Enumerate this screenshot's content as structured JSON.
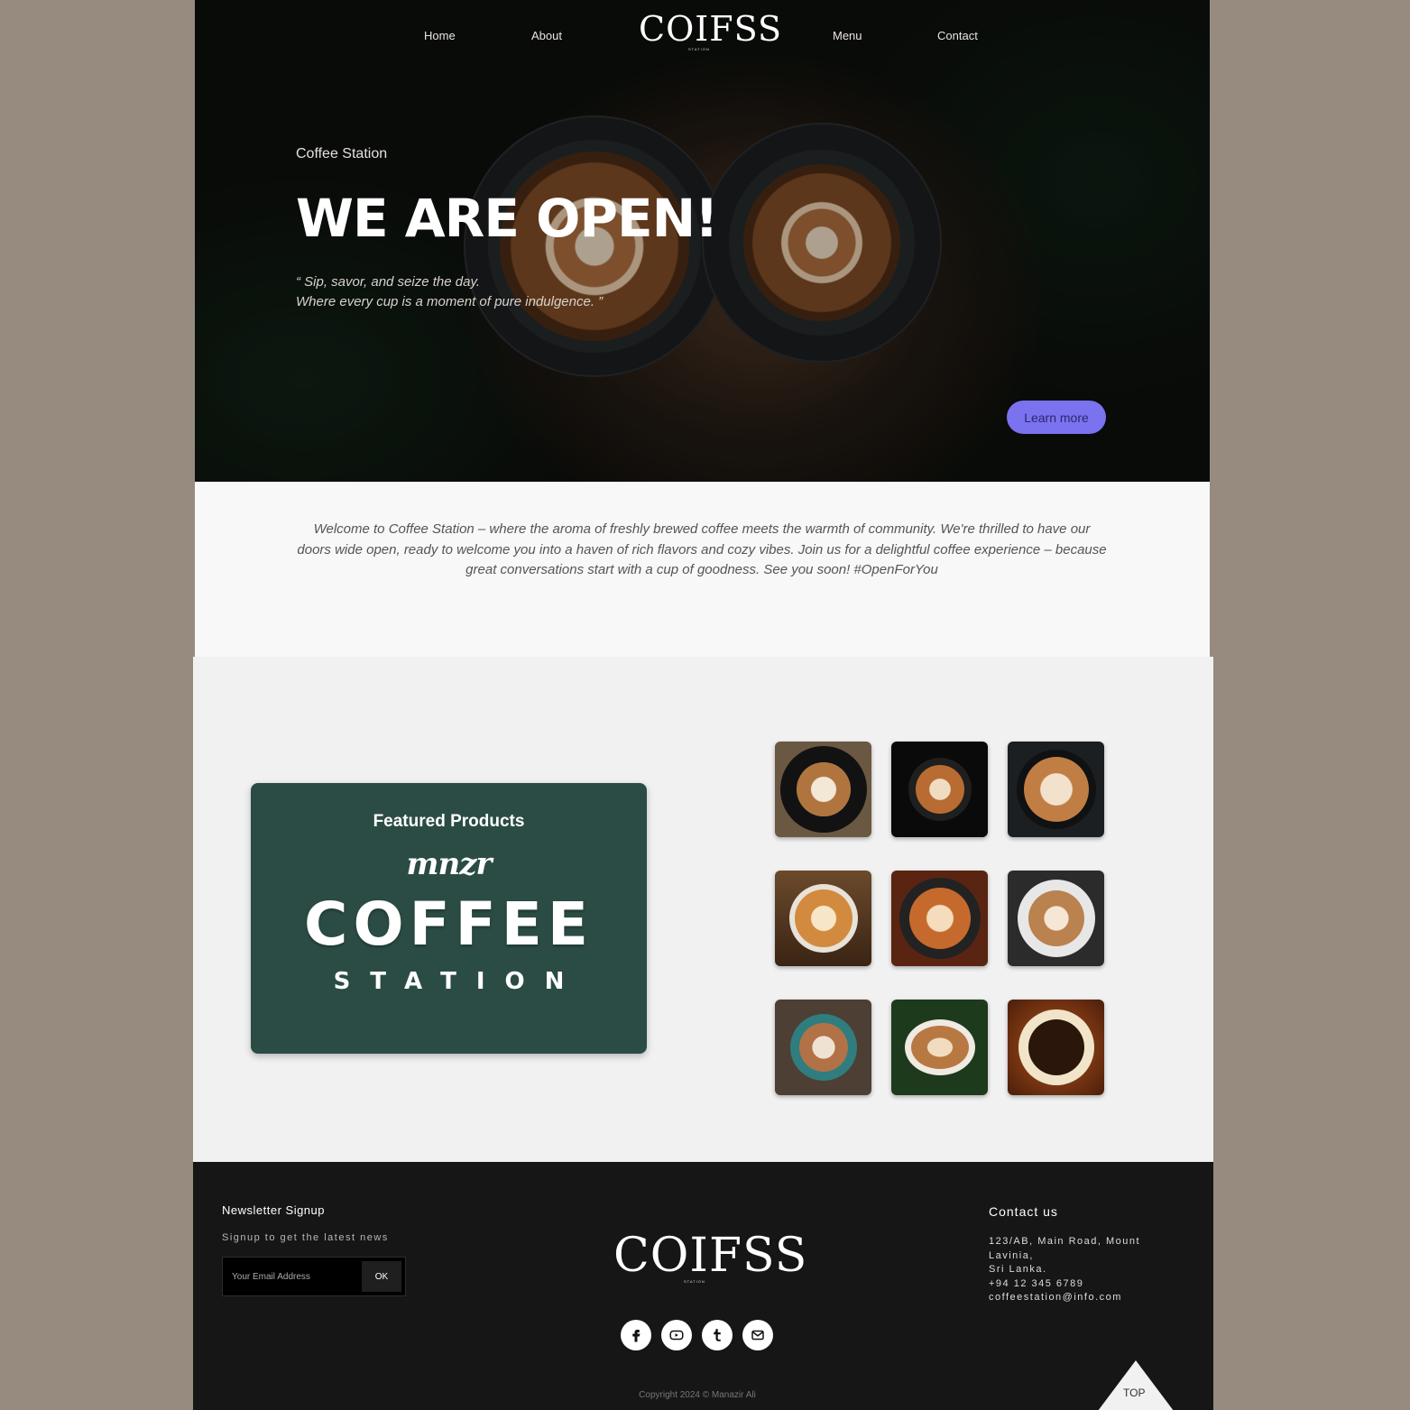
{
  "nav": {
    "items": [
      {
        "label": "Home"
      },
      {
        "label": "About"
      },
      {
        "label": "Menu"
      },
      {
        "label": "Contact"
      }
    ],
    "logo": "COIFSS",
    "logo_sub": "STATION"
  },
  "hero": {
    "kicker": "Coffee Station",
    "title": "WE ARE OPEN!",
    "quote_line1": "“ Sip, savor, and seize the day.",
    "quote_line2": "Where every cup is a moment of pure indulgence. ”",
    "cta": "Learn more",
    "cta_color": "#7b72ef"
  },
  "welcome": {
    "text": "Welcome to Coffee Station – where the aroma of freshly brewed coffee meets the warmth of community. We're thrilled to have our doors wide open, ready to welcome you into a haven of rich flavors and cozy vibes. Join us for a delightful coffee experience – because great conversations start with a cup of goodness. See you soon! #OpenForYou"
  },
  "featured": {
    "title": "Featured Products",
    "brand_script": "mnzr",
    "brand_big": "COFFEE",
    "brand_small": "STATION",
    "card_color": "#2b4c44",
    "gallery": [
      {
        "name": "heart-latte-black-cup"
      },
      {
        "name": "tulip-latte-black-bg"
      },
      {
        "name": "rosetta-latte-dark"
      },
      {
        "name": "heart-latte-wood"
      },
      {
        "name": "rosetta-latte-red-wood"
      },
      {
        "name": "heart-latte-white-cup"
      },
      {
        "name": "heart-latte-teal-cup"
      },
      {
        "name": "latte-on-grass"
      },
      {
        "name": "black-coffee-beans"
      }
    ]
  },
  "footer": {
    "newsletter_title": "Newsletter Signup",
    "newsletter_sub": "Signup to get the latest news",
    "email_placeholder": "Your Email Address",
    "ok_label": "OK",
    "logo": "COIFSS",
    "logo_sub": "STATION",
    "social": [
      "facebook-icon",
      "youtube-icon",
      "tumblr-icon",
      "mail-icon"
    ],
    "contact_title": "Contact us",
    "contact_lines": [
      "123/AB, Main Road, Mount",
      "Lavinia,",
      "Sri Lanka.",
      "+94 12 345 6789",
      "coffeestation@info.com"
    ],
    "copyright": "Copyright 2024 © Manazir Ali",
    "top_label": "TOP"
  }
}
